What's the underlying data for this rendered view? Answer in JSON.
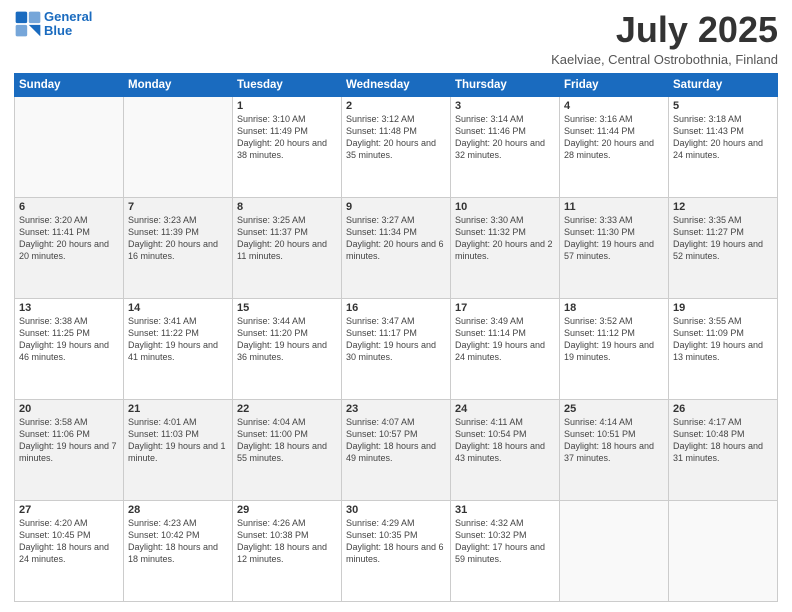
{
  "logo": {
    "line1": "General",
    "line2": "Blue"
  },
  "title": "July 2025",
  "location": "Kaelviae, Central Ostrobothnia, Finland",
  "days_header": [
    "Sunday",
    "Monday",
    "Tuesday",
    "Wednesday",
    "Thursday",
    "Friday",
    "Saturday"
  ],
  "weeks": [
    [
      {
        "day": "",
        "info": ""
      },
      {
        "day": "",
        "info": ""
      },
      {
        "day": "1",
        "info": "Sunrise: 3:10 AM\nSunset: 11:49 PM\nDaylight: 20 hours\nand 38 minutes."
      },
      {
        "day": "2",
        "info": "Sunrise: 3:12 AM\nSunset: 11:48 PM\nDaylight: 20 hours\nand 35 minutes."
      },
      {
        "day": "3",
        "info": "Sunrise: 3:14 AM\nSunset: 11:46 PM\nDaylight: 20 hours\nand 32 minutes."
      },
      {
        "day": "4",
        "info": "Sunrise: 3:16 AM\nSunset: 11:44 PM\nDaylight: 20 hours\nand 28 minutes."
      },
      {
        "day": "5",
        "info": "Sunrise: 3:18 AM\nSunset: 11:43 PM\nDaylight: 20 hours\nand 24 minutes."
      }
    ],
    [
      {
        "day": "6",
        "info": "Sunrise: 3:20 AM\nSunset: 11:41 PM\nDaylight: 20 hours\nand 20 minutes."
      },
      {
        "day": "7",
        "info": "Sunrise: 3:23 AM\nSunset: 11:39 PM\nDaylight: 20 hours\nand 16 minutes."
      },
      {
        "day": "8",
        "info": "Sunrise: 3:25 AM\nSunset: 11:37 PM\nDaylight: 20 hours\nand 11 minutes."
      },
      {
        "day": "9",
        "info": "Sunrise: 3:27 AM\nSunset: 11:34 PM\nDaylight: 20 hours\nand 6 minutes."
      },
      {
        "day": "10",
        "info": "Sunrise: 3:30 AM\nSunset: 11:32 PM\nDaylight: 20 hours\nand 2 minutes."
      },
      {
        "day": "11",
        "info": "Sunrise: 3:33 AM\nSunset: 11:30 PM\nDaylight: 19 hours\nand 57 minutes."
      },
      {
        "day": "12",
        "info": "Sunrise: 3:35 AM\nSunset: 11:27 PM\nDaylight: 19 hours\nand 52 minutes."
      }
    ],
    [
      {
        "day": "13",
        "info": "Sunrise: 3:38 AM\nSunset: 11:25 PM\nDaylight: 19 hours\nand 46 minutes."
      },
      {
        "day": "14",
        "info": "Sunrise: 3:41 AM\nSunset: 11:22 PM\nDaylight: 19 hours\nand 41 minutes."
      },
      {
        "day": "15",
        "info": "Sunrise: 3:44 AM\nSunset: 11:20 PM\nDaylight: 19 hours\nand 36 minutes."
      },
      {
        "day": "16",
        "info": "Sunrise: 3:47 AM\nSunset: 11:17 PM\nDaylight: 19 hours\nand 30 minutes."
      },
      {
        "day": "17",
        "info": "Sunrise: 3:49 AM\nSunset: 11:14 PM\nDaylight: 19 hours\nand 24 minutes."
      },
      {
        "day": "18",
        "info": "Sunrise: 3:52 AM\nSunset: 11:12 PM\nDaylight: 19 hours\nand 19 minutes."
      },
      {
        "day": "19",
        "info": "Sunrise: 3:55 AM\nSunset: 11:09 PM\nDaylight: 19 hours\nand 13 minutes."
      }
    ],
    [
      {
        "day": "20",
        "info": "Sunrise: 3:58 AM\nSunset: 11:06 PM\nDaylight: 19 hours\nand 7 minutes."
      },
      {
        "day": "21",
        "info": "Sunrise: 4:01 AM\nSunset: 11:03 PM\nDaylight: 19 hours\nand 1 minute."
      },
      {
        "day": "22",
        "info": "Sunrise: 4:04 AM\nSunset: 11:00 PM\nDaylight: 18 hours\nand 55 minutes."
      },
      {
        "day": "23",
        "info": "Sunrise: 4:07 AM\nSunset: 10:57 PM\nDaylight: 18 hours\nand 49 minutes."
      },
      {
        "day": "24",
        "info": "Sunrise: 4:11 AM\nSunset: 10:54 PM\nDaylight: 18 hours\nand 43 minutes."
      },
      {
        "day": "25",
        "info": "Sunrise: 4:14 AM\nSunset: 10:51 PM\nDaylight: 18 hours\nand 37 minutes."
      },
      {
        "day": "26",
        "info": "Sunrise: 4:17 AM\nSunset: 10:48 PM\nDaylight: 18 hours\nand 31 minutes."
      }
    ],
    [
      {
        "day": "27",
        "info": "Sunrise: 4:20 AM\nSunset: 10:45 PM\nDaylight: 18 hours\nand 24 minutes."
      },
      {
        "day": "28",
        "info": "Sunrise: 4:23 AM\nSunset: 10:42 PM\nDaylight: 18 hours\nand 18 minutes."
      },
      {
        "day": "29",
        "info": "Sunrise: 4:26 AM\nSunset: 10:38 PM\nDaylight: 18 hours\nand 12 minutes."
      },
      {
        "day": "30",
        "info": "Sunrise: 4:29 AM\nSunset: 10:35 PM\nDaylight: 18 hours\nand 6 minutes."
      },
      {
        "day": "31",
        "info": "Sunrise: 4:32 AM\nSunset: 10:32 PM\nDaylight: 17 hours\nand 59 minutes."
      },
      {
        "day": "",
        "info": ""
      },
      {
        "day": "",
        "info": ""
      }
    ]
  ]
}
